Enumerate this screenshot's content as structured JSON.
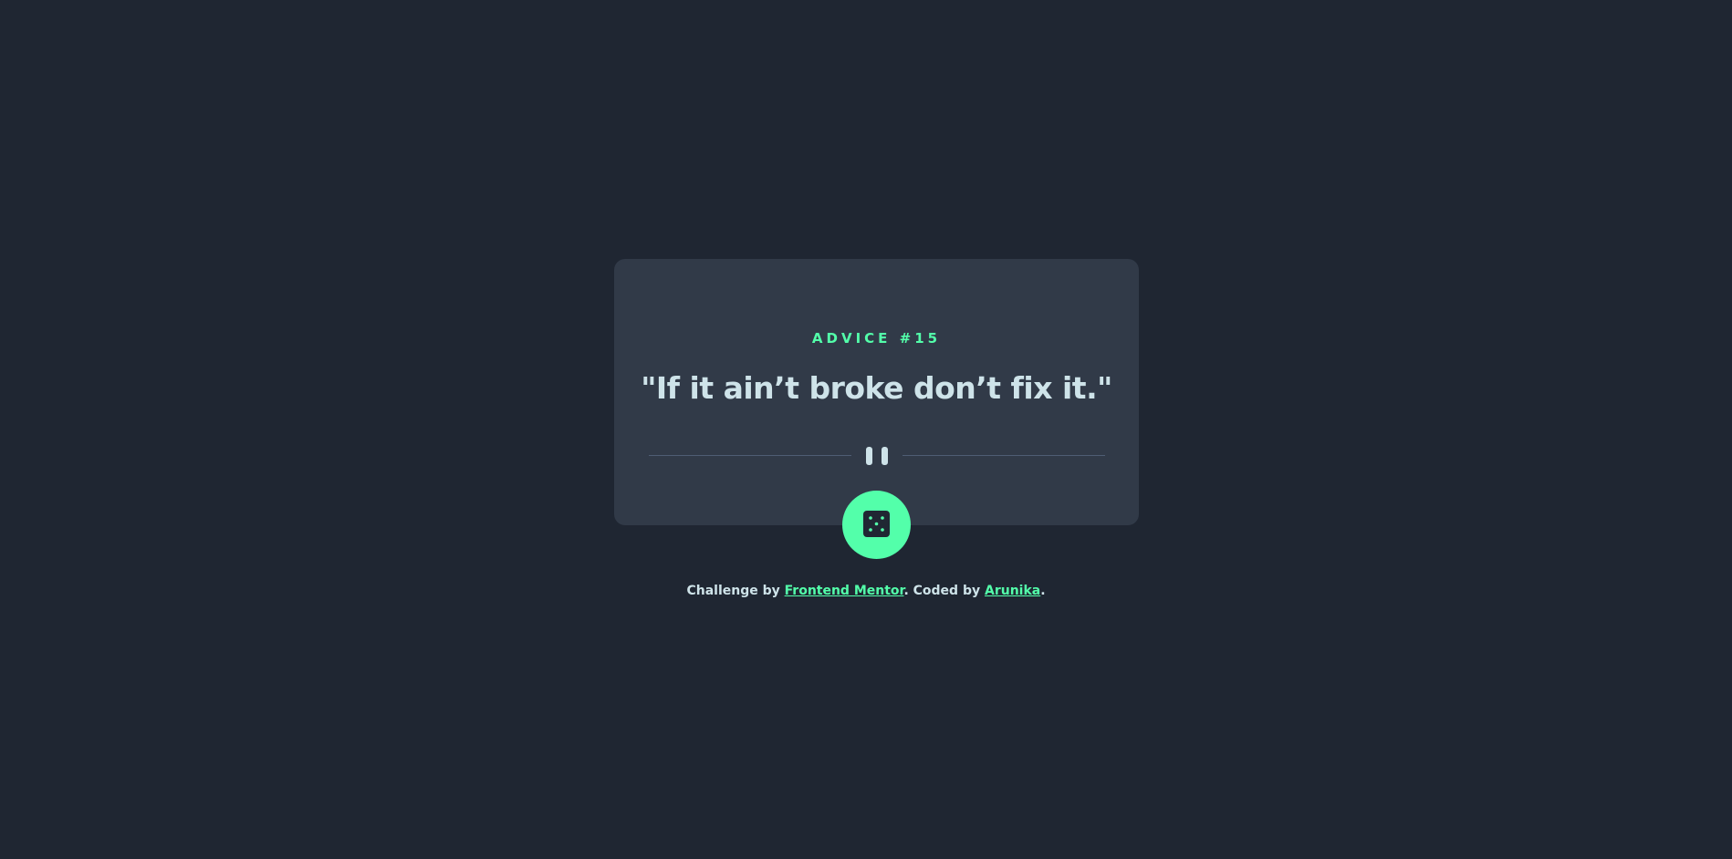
{
  "advice": {
    "label": "ADVICE #15",
    "quote": "\"If it ain’t broke don’t fix it.\""
  },
  "divider": {
    "icon": "pause-icon"
  },
  "dice_button": {
    "icon": "dice-icon"
  },
  "attribution": {
    "prefix": "Challenge by ",
    "challenge_link": "Frontend Mentor",
    "middle": ". Coded by ",
    "author_link": "Arunika",
    "suffix": "."
  },
  "colors": {
    "background": "#1f2632",
    "card": "#313a48",
    "accent": "#53ffaa",
    "text": "#cee3e9",
    "divider": "#4f5d74"
  }
}
